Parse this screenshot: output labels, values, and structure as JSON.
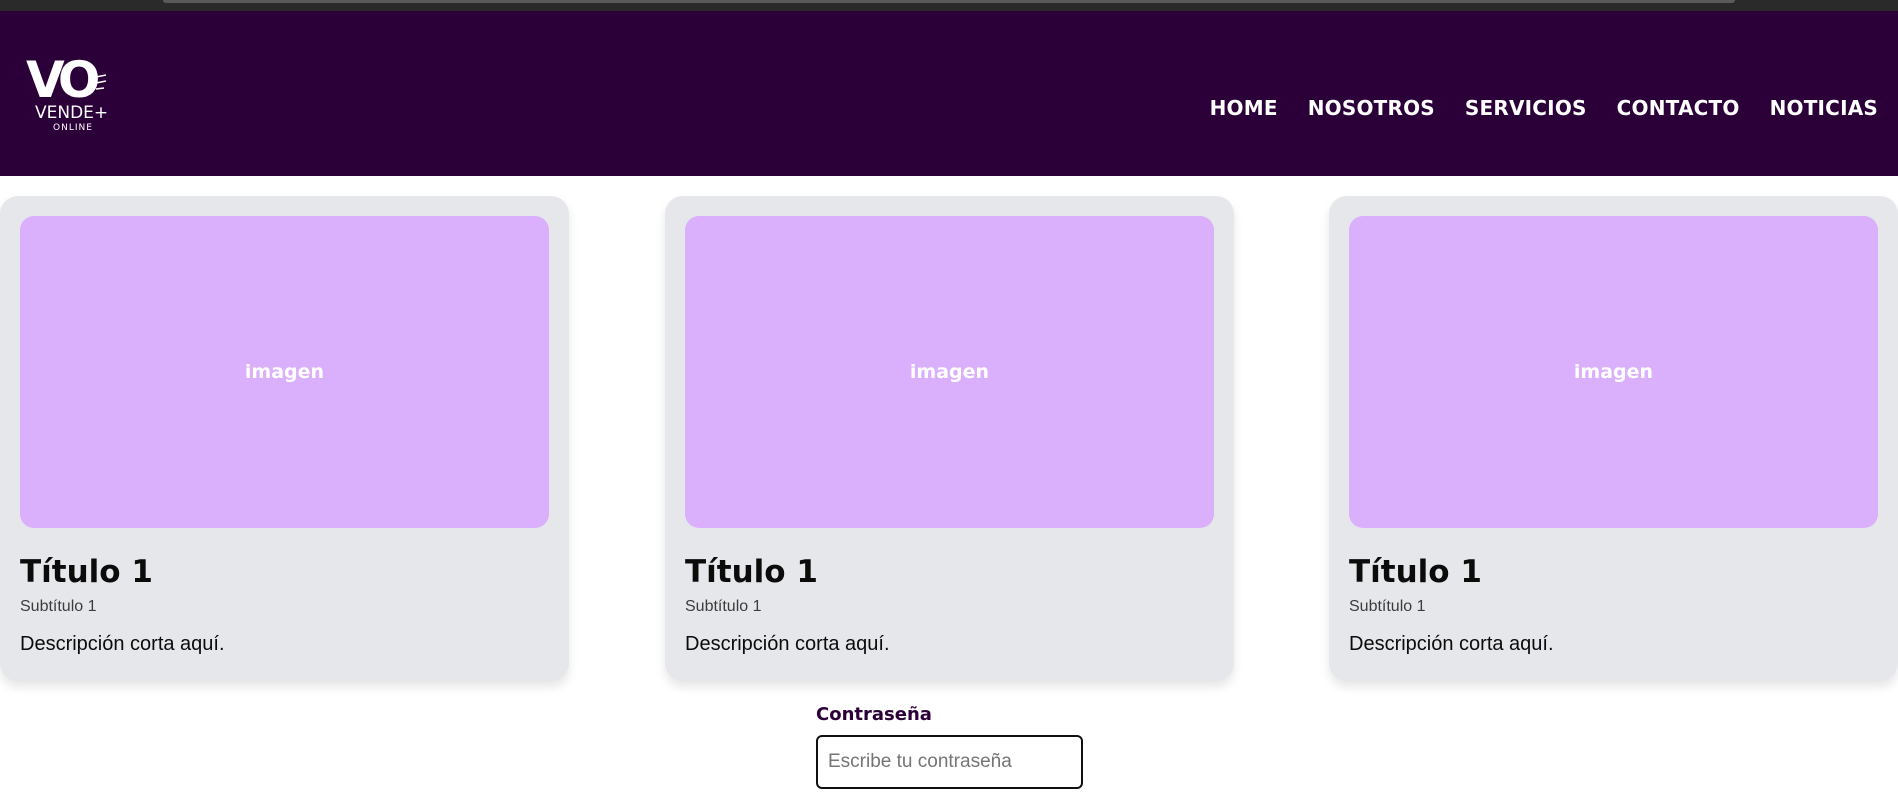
{
  "brand": {
    "logo_main": "VO",
    "logo_sub": "VENDE+",
    "logo_tag": "ONLINE",
    "colors": {
      "header_bg": "#2b0039",
      "card_bg": "#e5e7eb",
      "image_bg": "#dab0fd"
    }
  },
  "nav": {
    "items": [
      {
        "label": "HOME"
      },
      {
        "label": "NOSOTROS"
      },
      {
        "label": "SERVICIOS"
      },
      {
        "label": "CONTACTO"
      },
      {
        "label": "NOTICIAS"
      }
    ]
  },
  "cards": [
    {
      "image_label": "imagen",
      "title": "Título 1",
      "subtitle": "Subtítulo 1",
      "description": "Descripción corta aquí."
    },
    {
      "image_label": "imagen",
      "title": "Título 1",
      "subtitle": "Subtítulo 1",
      "description": "Descripción corta aquí."
    },
    {
      "image_label": "imagen",
      "title": "Título 1",
      "subtitle": "Subtítulo 1",
      "description": "Descripción corta aquí."
    }
  ],
  "password": {
    "label": "Contraseña",
    "placeholder": "Escribe tu contraseña",
    "value": ""
  }
}
